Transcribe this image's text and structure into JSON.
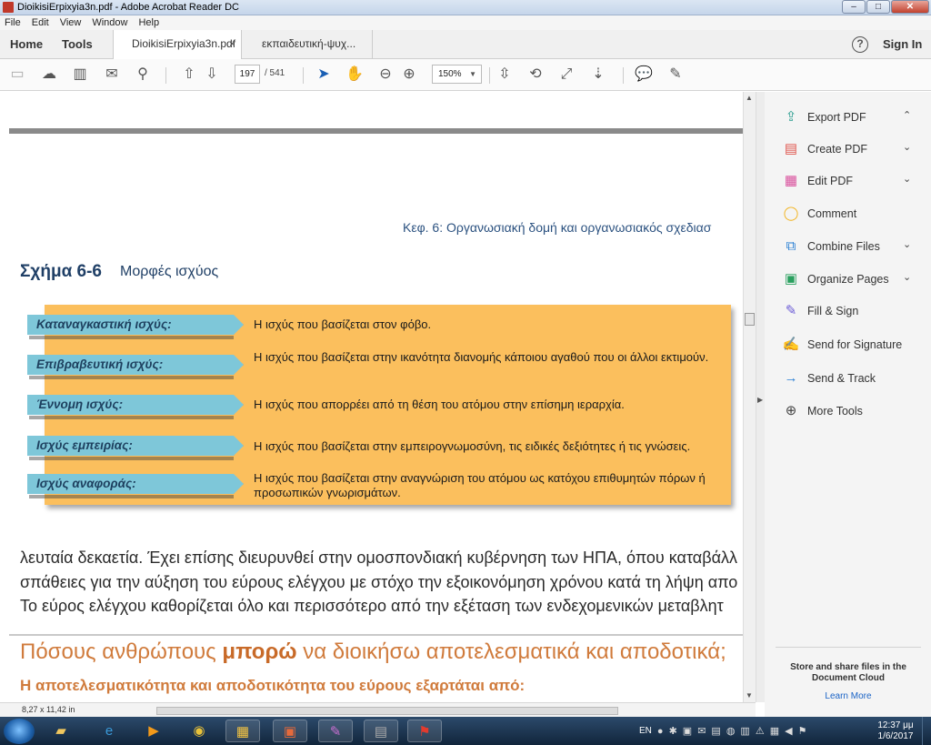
{
  "window": {
    "title": "DioikisiErpixyia3n.pdf - Adobe Acrobat Reader DC",
    "controls": [
      "–",
      "□",
      "✕"
    ]
  },
  "menu": [
    "File",
    "Edit",
    "View",
    "Window",
    "Help"
  ],
  "tabs": {
    "home": "Home",
    "tools": "Tools",
    "doc1": "DioikisiErpixyia3n.pdf",
    "doc2": "εκπαιδευτική-ψυχ...",
    "close": "×",
    "signin": "Sign In",
    "help": "?"
  },
  "toolbar": {
    "page_current": "197",
    "page_total": "/ 541",
    "zoom": "150%"
  },
  "document": {
    "chapter_header": "Κεφ. 6: Οργανωσιακή δομή και οργανωσιακός σχεδιασ",
    "figure_number": "Σχήμα 6-6",
    "figure_title": "Μορφές ισχύος",
    "rows": [
      {
        "label": "Καταναγκαστική ισχύς:",
        "desc": "Η ισχύς που βασίζεται στον φόβο."
      },
      {
        "label": "Επιβραβευτική ισχύς:",
        "desc": "Η ισχύς που βασίζεται στην ικανότητα διανομής κάποιου αγαθού που οι άλλοι εκτιμούν."
      },
      {
        "label": "Έννομη ισχύς:",
        "desc": "Η ισχύς που απορρέει από τη θέση του ατόμου στην επίσημη ιεραρχία."
      },
      {
        "label": "Ισχύς εμπειρίας:",
        "desc": "Η ισχύς που βασίζεται στην εμπειρογνωμοσύνη, τις ειδικές δεξιότητες ή τις γνώσεις."
      },
      {
        "label": "Ισχύς αναφοράς:",
        "desc": "Η ισχύς που βασίζεται στην αναγνώριση του ατόμου ως κατόχου επιθυμητών πόρων ή προσωπικών γνωρισμάτων."
      }
    ],
    "body_lines": [
      "λευταία δεκαετία. Έχει επίσης διευρυνθεί στην ομοσπονδιακή κυβέρνηση των ΗΠΑ, όπου καταβάλλ",
      "σπάθειες για την αύξηση του εύρους ελέγχου με στόχο την εξοικονόμηση χρόνου κατά τη λήψη απο",
      "Το εύρος ελέγχου καθορίζεται όλο και περισσότερο από την εξέταση των ενδεχομενικών μεταβλητ"
    ],
    "section_title_pre": "Πόσους ανθρώπους ",
    "section_title_bold": "μπορώ",
    "section_title_post": " να διοικήσω αποτελεσματικά και αποδοτικά;",
    "sub_heading": "Η αποτελεσματικότητα και αποδοτικότητα του εύρους εξαρτάται από:"
  },
  "status": {
    "page_size": "8,27 x 11,42 in"
  },
  "tools_pane": {
    "items": [
      {
        "label": "Export PDF",
        "icon": "export-pdf-icon",
        "glyph": "⇪",
        "color": "#2a9d8f",
        "caret": "⌃"
      },
      {
        "label": "Create PDF",
        "icon": "create-pdf-icon",
        "glyph": "▤",
        "color": "#e0574f",
        "caret": "⌄"
      },
      {
        "label": "Edit PDF",
        "icon": "edit-pdf-icon",
        "glyph": "▦",
        "color": "#d94f9c",
        "caret": "⌄"
      },
      {
        "label": "Comment",
        "icon": "comment-icon",
        "glyph": "◯",
        "color": "#f2b21b",
        "caret": ""
      },
      {
        "label": "Combine Files",
        "icon": "combine-files-icon",
        "glyph": "⧉",
        "color": "#2a7fd4",
        "caret": "⌄"
      },
      {
        "label": "Organize Pages",
        "icon": "organize-pages-icon",
        "glyph": "▣",
        "color": "#2aa05f",
        "caret": "⌄"
      },
      {
        "label": "Fill & Sign",
        "icon": "fill-sign-icon",
        "glyph": "✎",
        "color": "#6b5bd6",
        "caret": ""
      },
      {
        "label": "Send for Signature",
        "icon": "send-signature-icon",
        "glyph": "✍",
        "color": "#5a6fd0",
        "caret": ""
      },
      {
        "label": "Send & Track",
        "icon": "send-track-icon",
        "glyph": "→",
        "color": "#2a7fd4",
        "caret": ""
      },
      {
        "label": "More Tools",
        "icon": "more-tools-icon",
        "glyph": "⊕",
        "color": "#444444",
        "caret": ""
      }
    ],
    "cloud_text": "Store and share files in the Document Cloud",
    "cloud_link": "Learn More"
  },
  "taskbar": {
    "lang": "EN",
    "time": "12:37 μμ",
    "date": "1/6/2017"
  },
  "colors": {
    "accent_orange_panel": "#fbbf5d",
    "tag_blue": "#7ec7d9",
    "heading_blue": "#1f3f66",
    "section_orange": "#d07b3c"
  }
}
